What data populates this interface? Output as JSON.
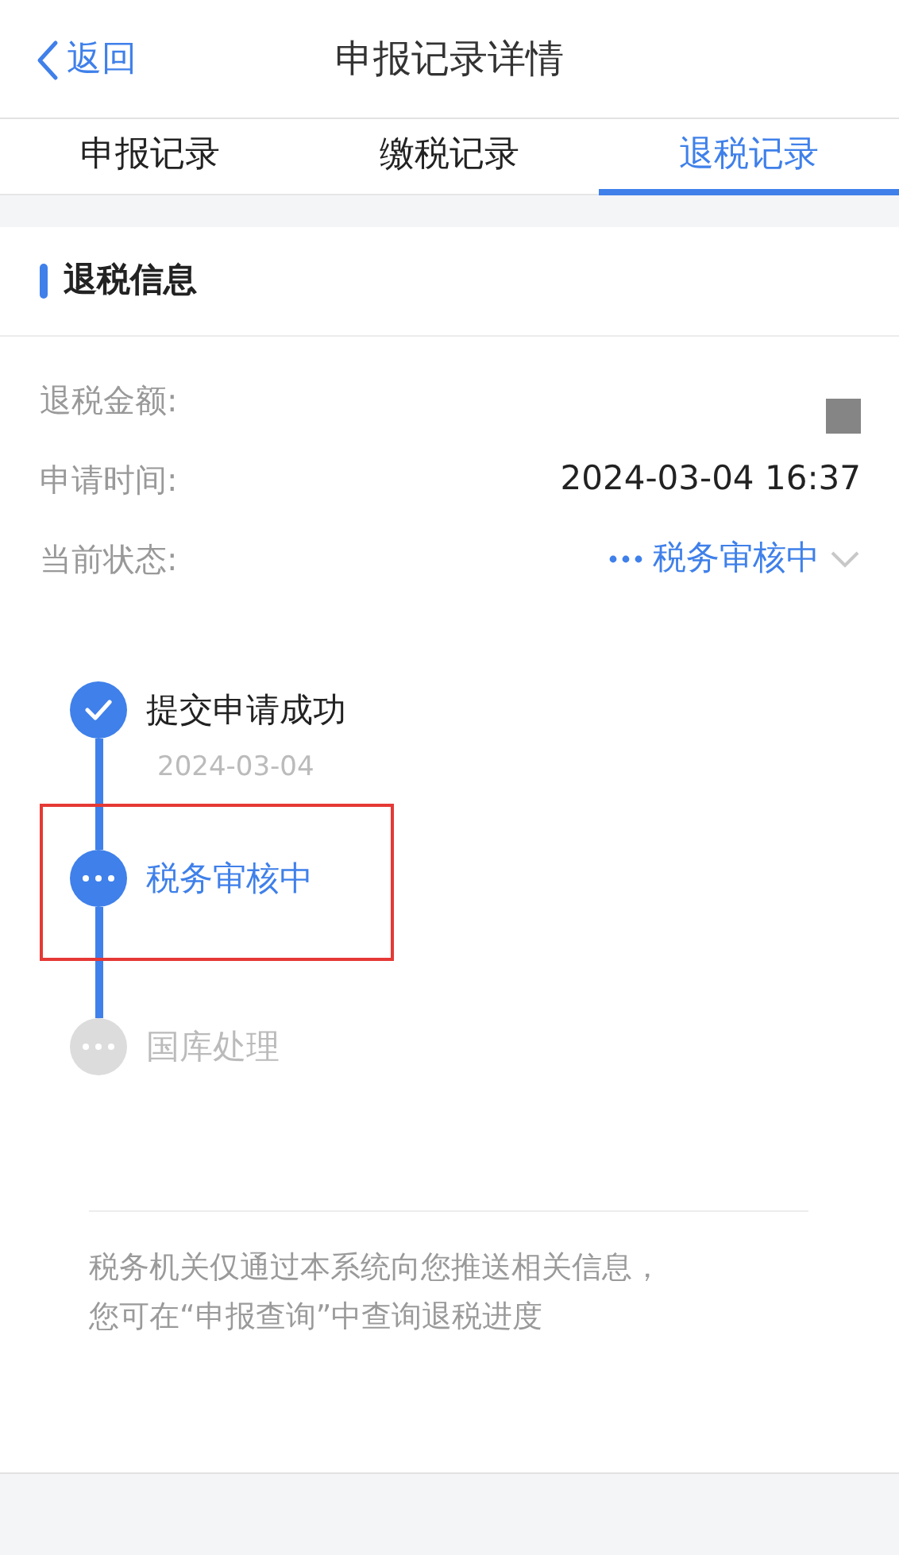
{
  "nav": {
    "back": "返回",
    "title": "申报记录详情"
  },
  "tabs": [
    {
      "label": "申报记录",
      "selected": false
    },
    {
      "label": "缴税记录",
      "selected": false
    },
    {
      "label": "退税记录",
      "selected": true
    }
  ],
  "section": {
    "title": "退税信息"
  },
  "fields": [
    {
      "label": "退税金额:",
      "kind": "redacted"
    },
    {
      "label": "申请时间:",
      "kind": "text",
      "value": "2024-03-04 16:37"
    },
    {
      "label": "当前状态:",
      "kind": "status",
      "value": "税务审核中"
    }
  ],
  "steps": [
    {
      "title": "提交申请成功",
      "kind": "done",
      "date": "2024-03-04",
      "highlighted": false
    },
    {
      "title": "税务审核中",
      "kind": "active",
      "highlighted": true
    },
    {
      "title": "国库处理",
      "kind": "pending",
      "highlighted": false
    }
  ],
  "note": [
    "税务机关仅通过本系统向您推送相关信息，",
    "您可在“申报查询”中查询退税进度"
  ]
}
